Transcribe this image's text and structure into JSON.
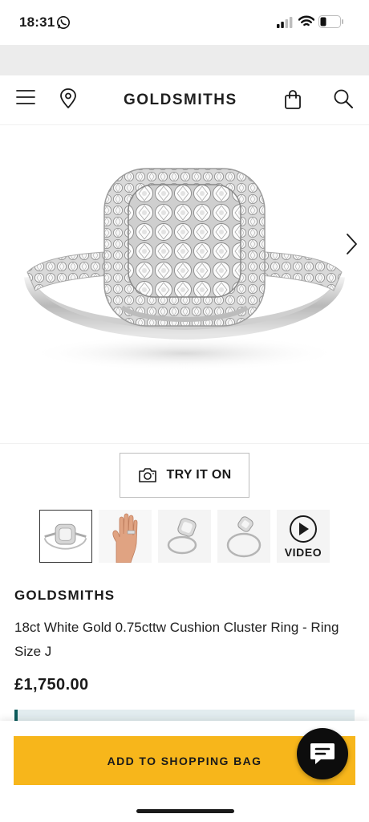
{
  "status_bar": {
    "time": "18:31"
  },
  "header": {
    "brand": "GOLDSMITHS"
  },
  "try_on": {
    "label": "TRY IT ON"
  },
  "thumbnails": {
    "video_label": "VIDEO"
  },
  "product": {
    "brand": "GOLDSMITHS",
    "title": "18ct White Gold 0.75cttw Cushion Cluster Ring - Ring Size J",
    "price": "£1,750.00"
  },
  "cart": {
    "add_label": "ADD TO SHOPPING BAG"
  },
  "colors": {
    "accent": "#f7b61b",
    "info_strip": "#e2ecef",
    "info_bar": "#0d5c5c"
  }
}
